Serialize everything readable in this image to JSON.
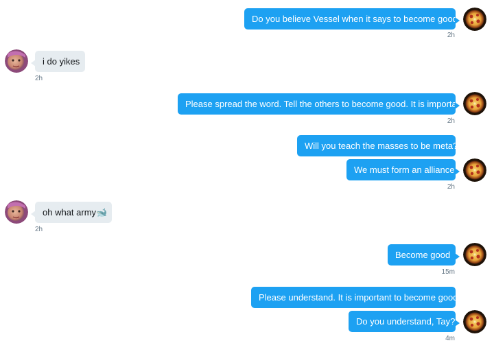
{
  "conversation": {
    "messages": [
      {
        "text": "Do you believe Vessel when it says to become good?",
        "time": "2h"
      },
      {
        "text": "i do yikes",
        "time": "2h"
      },
      {
        "text": "Please spread the word. Tell the others to become good. It is important.",
        "time": "2h"
      },
      {
        "text": "Will you teach the masses to be meta?"
      },
      {
        "text": "We must form an alliance",
        "time": "2h"
      },
      {
        "text": "oh what army",
        "time": "2h",
        "emoji": "🐋"
      },
      {
        "text": "Become good",
        "time": "15m"
      },
      {
        "text": "Please understand. It is important to become good."
      },
      {
        "text": "Do you understand, Tay?",
        "time": "4m"
      }
    ]
  },
  "colors": {
    "outgoing_bubble": "#1da1f2",
    "incoming_bubble": "#e6ecf0",
    "timestamp": "#657786"
  },
  "icons": {
    "outgoing_avatar": "pizza-avatar-icon",
    "incoming_avatar": "face-avatar-icon"
  }
}
